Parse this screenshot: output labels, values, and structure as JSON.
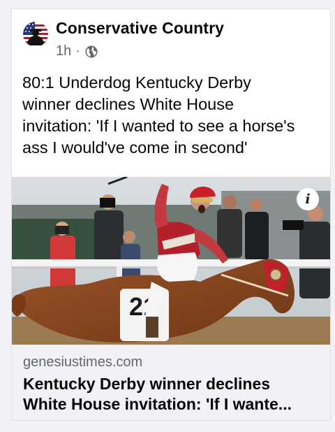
{
  "post": {
    "page_name": "Conservative Country",
    "time": "1h",
    "separator": "·",
    "audience_icon": "globe-icon",
    "text_lines": [
      "80:1 Underdog Kentucky Derby",
      "winner declines White House",
      "invitation: 'If I wanted to see a horse's",
      "ass I would've come in second'"
    ]
  },
  "link_preview": {
    "info_icon": "info-icon",
    "info_label": "i",
    "domain": "genesiustimes.com",
    "title_lines": [
      "Kentucky Derby winner declines",
      "White House invitation: 'If I wante..."
    ]
  },
  "colors": {
    "background": "#f0f2f5",
    "card": "#ffffff",
    "secondary_text": "#65676b",
    "jockey_silks": "#b3202a",
    "horse": "#8a4a25"
  }
}
